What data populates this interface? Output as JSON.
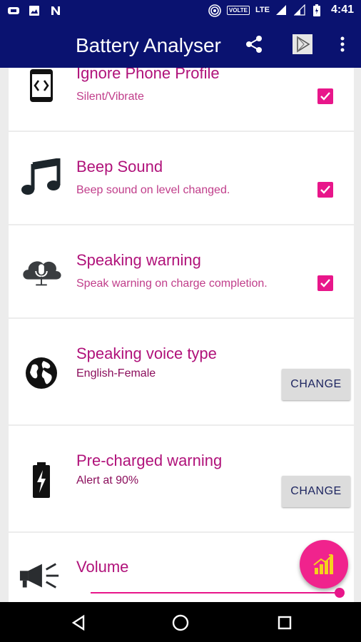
{
  "status_bar": {
    "network_label": "VOLTE",
    "lte_label": "LTE",
    "time": "4:41"
  },
  "app": {
    "title": "Battery Analyser"
  },
  "settings": [
    {
      "title": "Ignore Phone Profile",
      "subtitle": "Silent/Vibrate",
      "checked": true,
      "icon": "phone-code-icon"
    },
    {
      "title": "Beep Sound",
      "subtitle": "Beep sound on level changed.",
      "checked": true,
      "icon": "music-note-icon"
    },
    {
      "title": "Speaking warning",
      "subtitle": "Speak warning on charge completion.",
      "checked": true,
      "icon": "cloud-mic-icon"
    },
    {
      "title": "Speaking voice type",
      "subtitle": "English-Female",
      "button": "CHANGE",
      "icon": "globe-icon"
    },
    {
      "title": "Pre-charged warning",
      "subtitle": "Alert at 90%",
      "button": "CHANGE",
      "icon": "battery-charging-icon"
    },
    {
      "title": "Volume",
      "icon": "megaphone-icon",
      "slider_value_percent": 100
    }
  ],
  "colors": {
    "primary": "#0a1270",
    "accent": "#e8168a",
    "title_text": "#b0127a"
  }
}
